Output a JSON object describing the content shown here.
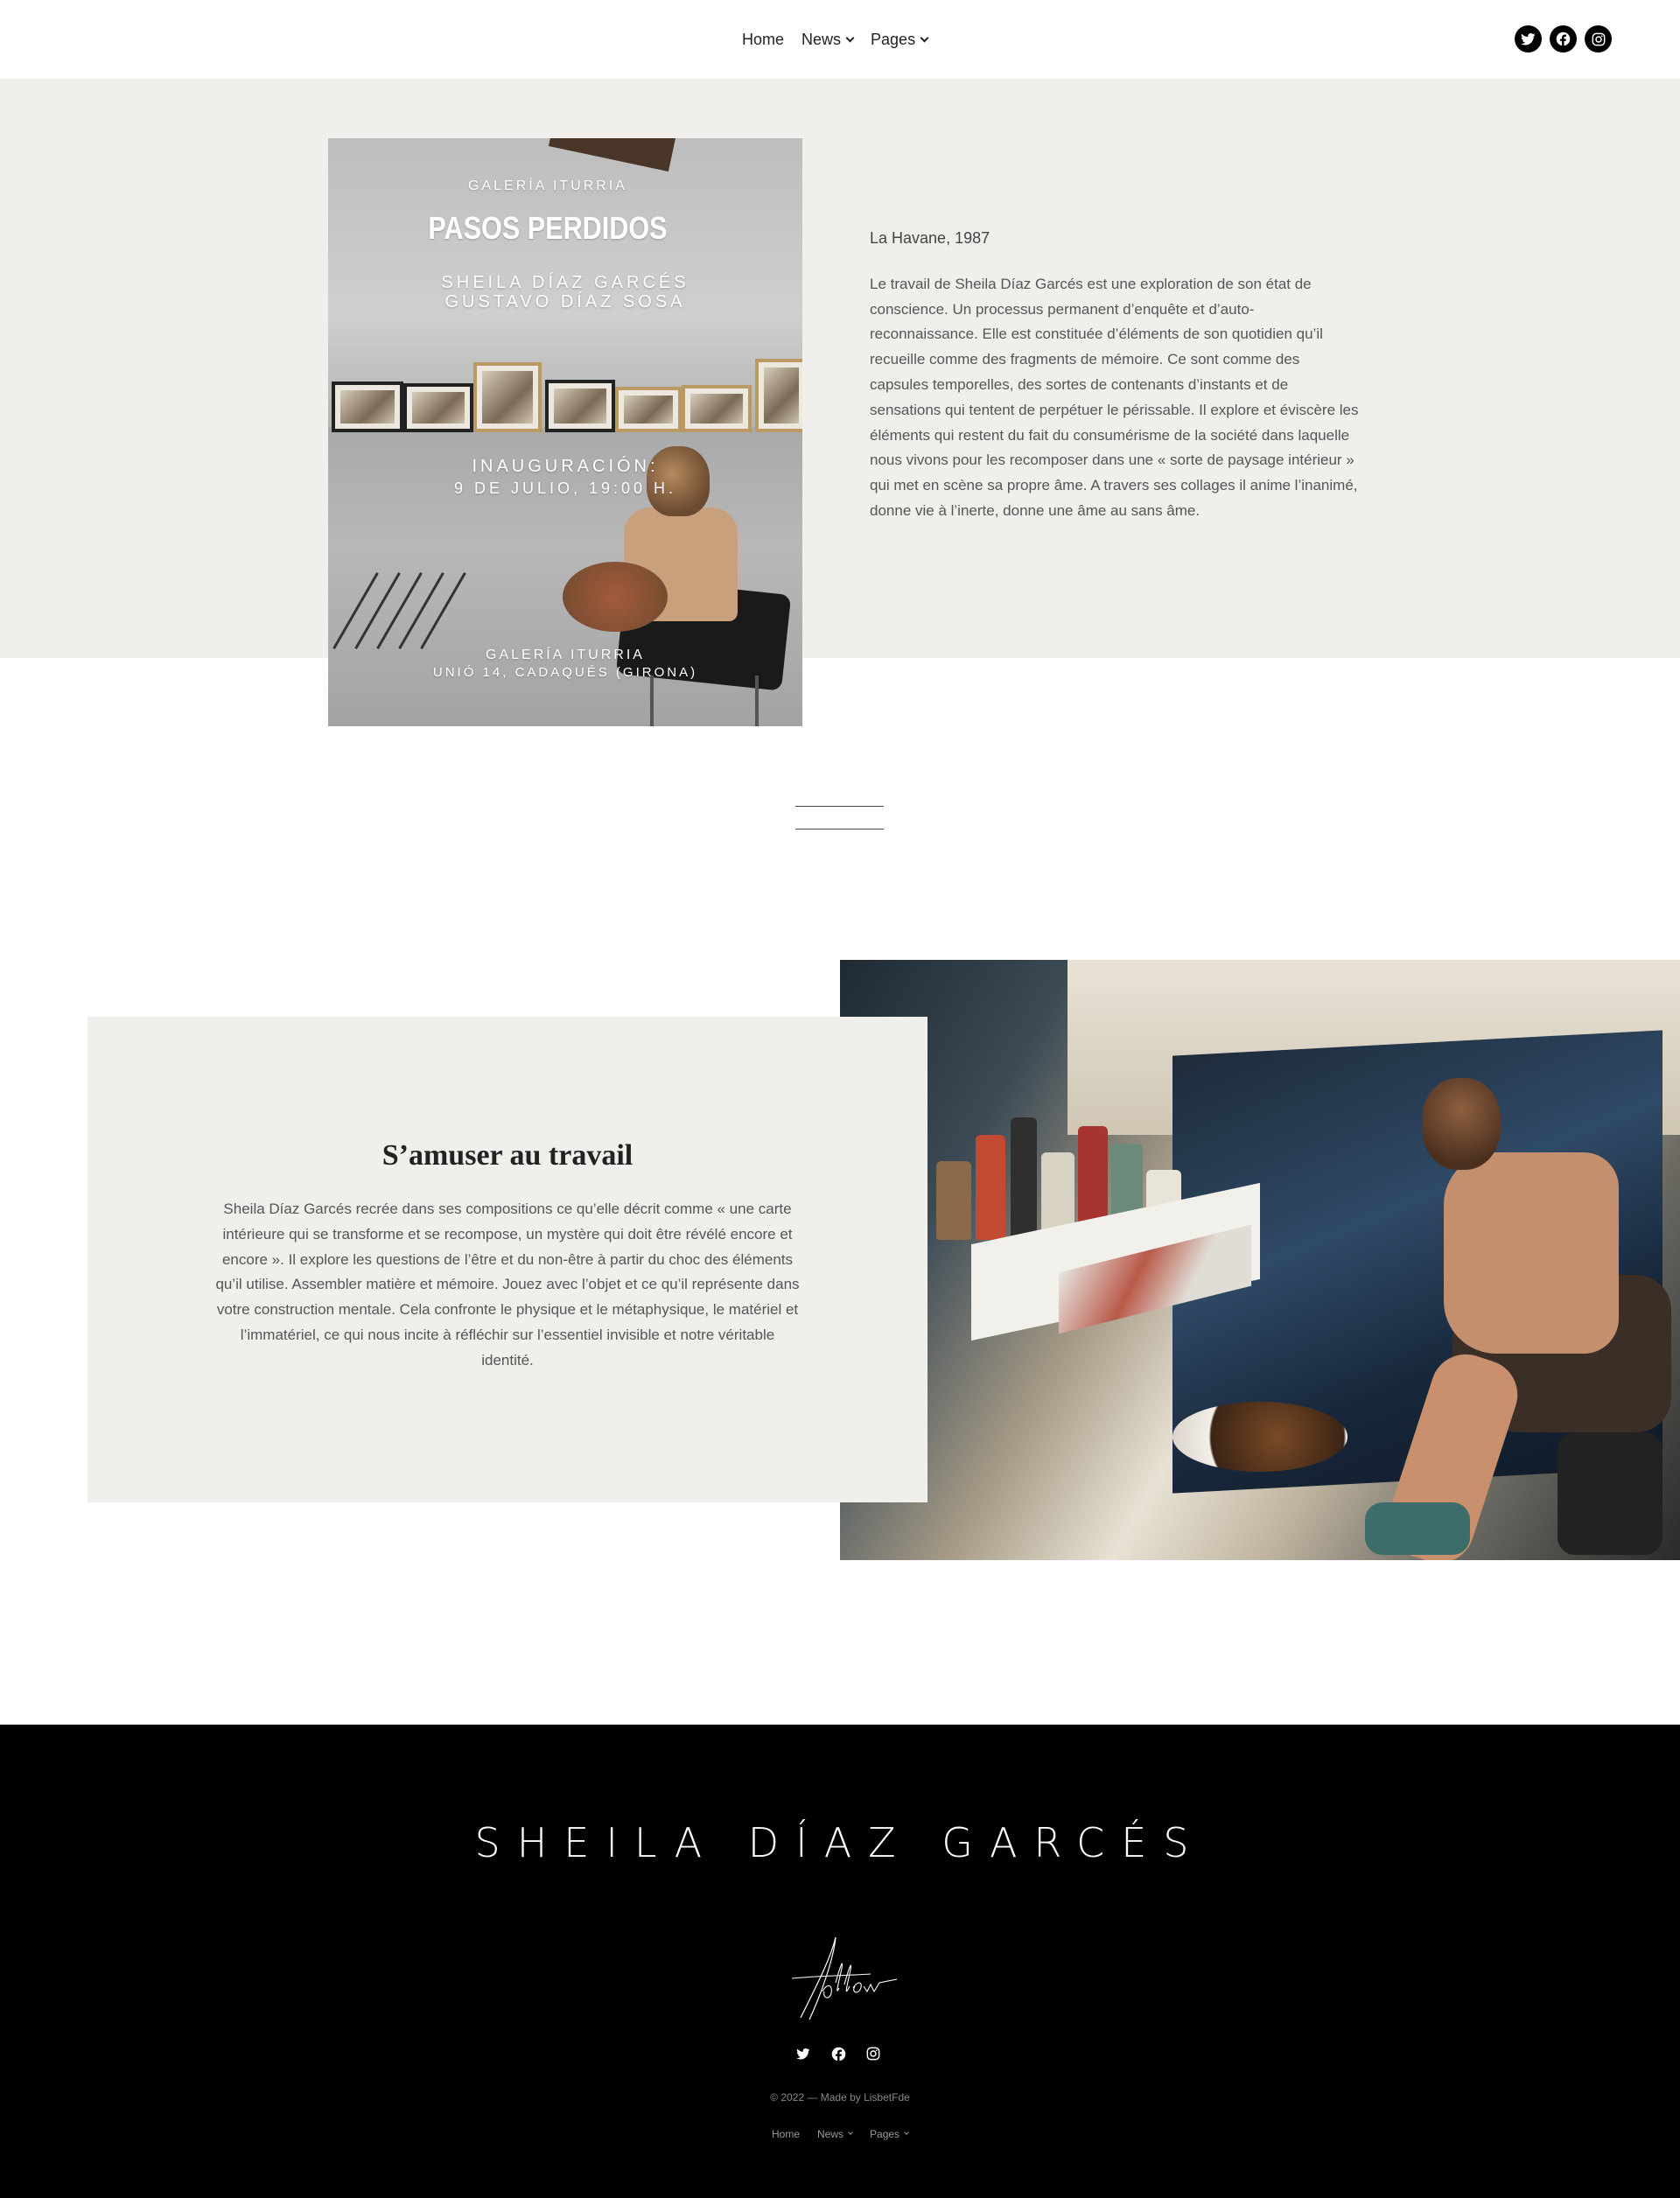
{
  "header": {
    "nav": [
      {
        "label": "Home",
        "has_dropdown": false
      },
      {
        "label": "News",
        "has_dropdown": true
      },
      {
        "label": "Pages",
        "has_dropdown": true
      }
    ],
    "social": [
      "twitter-icon",
      "facebook-icon",
      "instagram-icon"
    ]
  },
  "hero": {
    "poster": {
      "gallery": "GALERÍA ITURRIA",
      "title": "PASOS PERDIDOS",
      "artist1": "SHEILA DÍAZ GARCÉS",
      "artist2": "GUSTAVO DÍAZ SOSA",
      "inauguration": "INAUGURACIÓN:",
      "date": "9 DE JULIO, 19:00 H.",
      "venue": "GALERÍA ITURRIA",
      "address": "UNIÓ 14, CADAQUÉS (GIRONA)"
    },
    "place": "La Havane, 1987",
    "paragraph": "Le travail de Sheila Díaz Garcés est une exploration de son état de conscience. Un processus permanent d’enquête et d’auto-reconnaissance. Elle est constituée d’éléments de son quotidien qu’il recueille comme des fragments de mémoire. Ce sont comme des capsules temporelles, des sortes de contenants d’instants et de sensations qui tentent de perpétuer le périssable. Il explore et éviscère les éléments qui restent du fait du consumérisme de la société dans laquelle nous vivons pour les recomposer dans une « sorte de paysage intérieur » qui met en scène sa propre âme. A travers ses collages il anime l’inanimé, donne vie à l’inerte, donne une âme au sans âme."
  },
  "section2": {
    "title": "S’amuser au travail",
    "paragraph": "Sheila Díaz Garcés recrée dans ses compositions ce qu’elle décrit comme « une carte intérieure qui se transforme et se recompose, un mystère qui doit être révélé encore et encore ». Il explore les questions de l’être et du non-être à partir du choc des éléments qu’il utilise. Assembler matière et mémoire. Jouez avec l’objet et ce qu’il représente dans votre construction mentale. Cela confronte le physique et le métaphysique, le matériel et l’immatériel, ce qui nous incite à réfléchir sur l’essentiel invisible et notre véritable identité."
  },
  "footer": {
    "title": "SHEILA DÍAZ GARCÉS",
    "follow": "follow",
    "social": [
      "twitter-icon",
      "facebook-icon",
      "instagram-icon"
    ],
    "copyright": "© 2022 — Made by LisbetFde",
    "nav": [
      {
        "label": "Home",
        "has_dropdown": false
      },
      {
        "label": "News",
        "has_dropdown": true
      },
      {
        "label": "Pages",
        "has_dropdown": true
      }
    ]
  },
  "colors": {
    "band": "#f0efeb",
    "footer_bg": "#000000",
    "text": "#555555"
  }
}
